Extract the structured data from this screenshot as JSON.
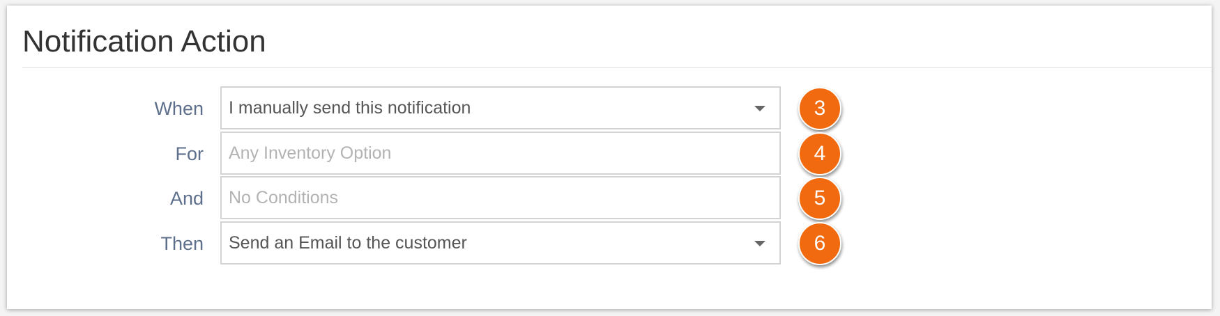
{
  "panel": {
    "title": "Notification Action"
  },
  "rows": [
    {
      "label": "When",
      "value": "I manually send this notification",
      "is_placeholder": false,
      "has_dropdown": true,
      "badge": "3"
    },
    {
      "label": "For",
      "value": "Any Inventory Option",
      "is_placeholder": true,
      "has_dropdown": false,
      "badge": "4"
    },
    {
      "label": "And",
      "value": "No Conditions",
      "is_placeholder": true,
      "has_dropdown": false,
      "badge": "5"
    },
    {
      "label": "Then",
      "value": "Send an Email to the customer",
      "is_placeholder": false,
      "has_dropdown": true,
      "badge": "6"
    }
  ],
  "icons": {
    "dropdown": "chevron-down-icon"
  },
  "colors": {
    "label": "#5e6f8c",
    "badge": "#f26a10",
    "field_border": "#d3d3d3",
    "placeholder": "#b3b3b3"
  }
}
